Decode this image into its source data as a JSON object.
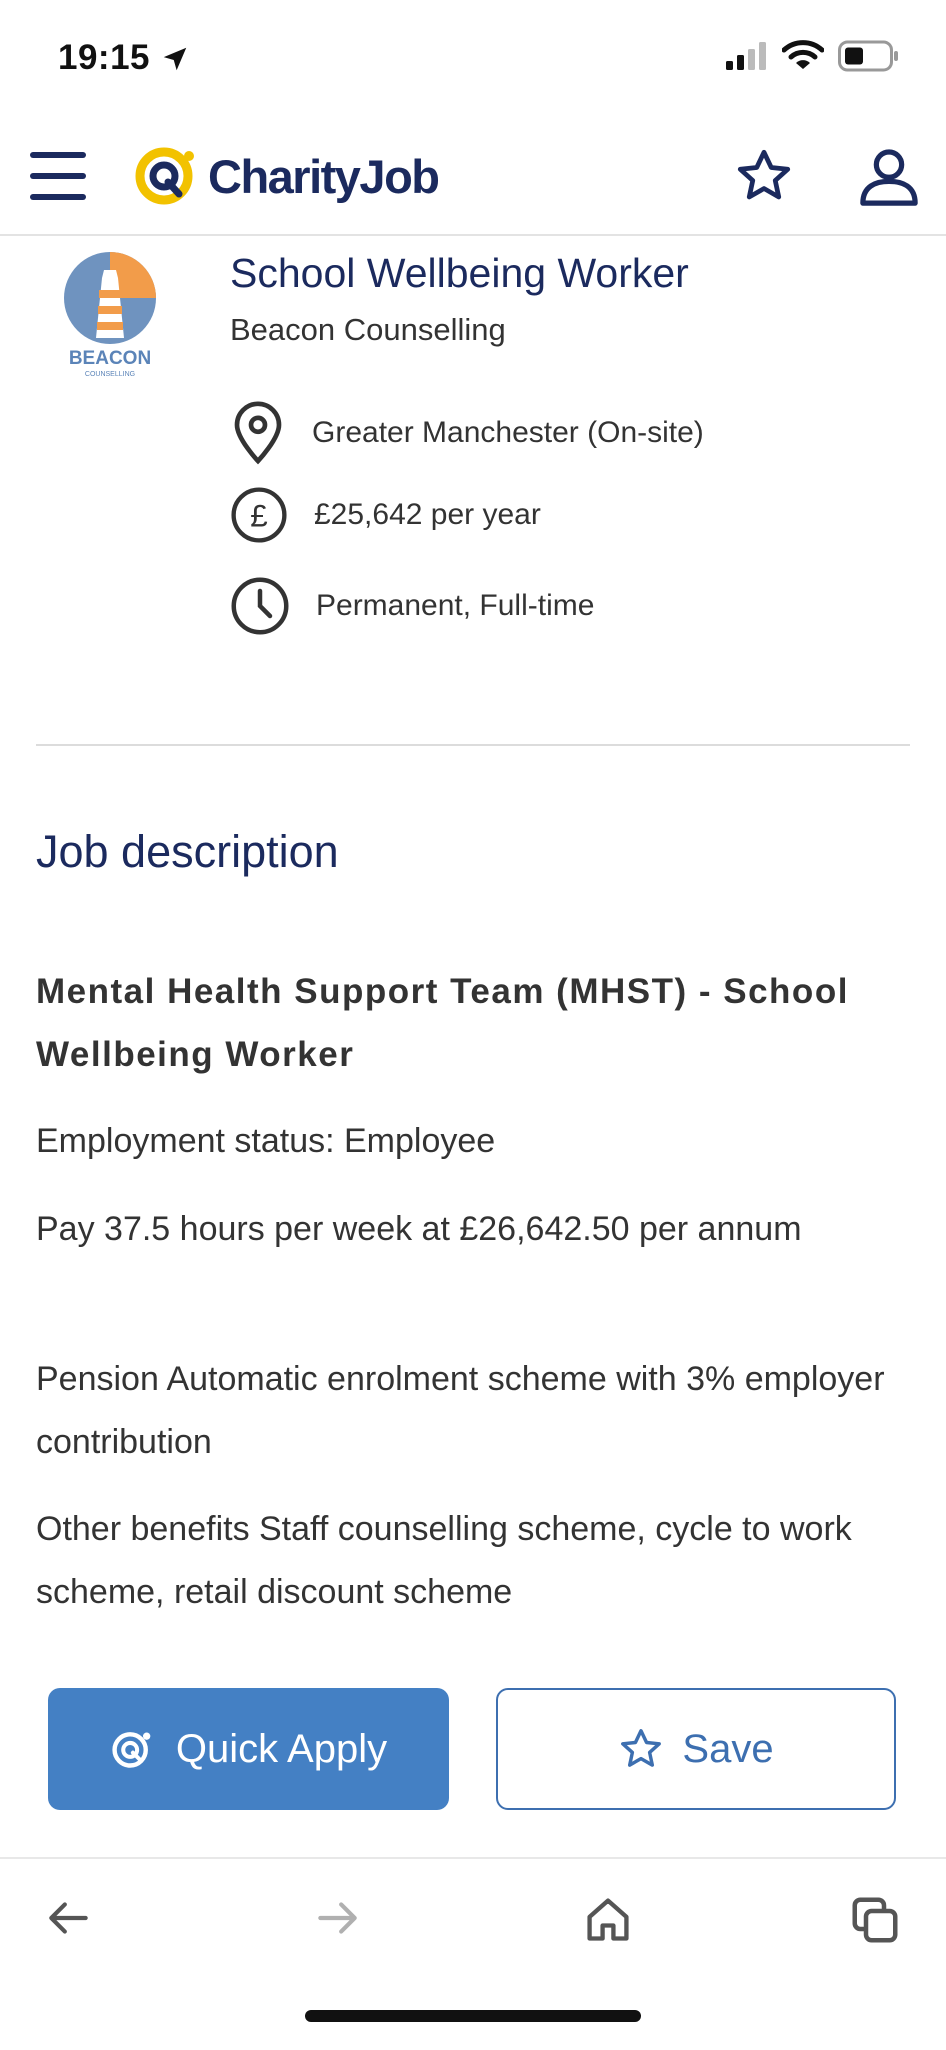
{
  "status_bar": {
    "time": "19:15"
  },
  "header": {
    "logo_text": "CharityJob",
    "icons": [
      "menu-icon",
      "star-icon",
      "user-icon"
    ]
  },
  "job": {
    "logo_text": "BEACON",
    "logo_subtext": "COUNSELLING",
    "title": "School Wellbeing Worker",
    "company": "Beacon Counselling",
    "location": "Greater Manchester (On-site)",
    "salary": "£25,642 per year",
    "contract": "Permanent, Full-time"
  },
  "description": {
    "section_title": "Job description",
    "heading": "Mental Health Support Team (MHST) - School Wellbeing Worker",
    "paragraphs": [
      "Employment status: Employee",
      "Pay 37.5 hours per week at £26,642.50 per annum",
      "Pension Automatic enrolment scheme with 3% employer contribution",
      "Other benefits Staff counselling scheme, cycle to work scheme, retail discount scheme"
    ]
  },
  "actions": {
    "quick_apply_label": "Quick Apply",
    "save_label": "Save"
  },
  "colors": {
    "brand_navy": "#1b2a5e",
    "brand_yellow": "#f2c200",
    "apply_blue": "#4480c4"
  }
}
